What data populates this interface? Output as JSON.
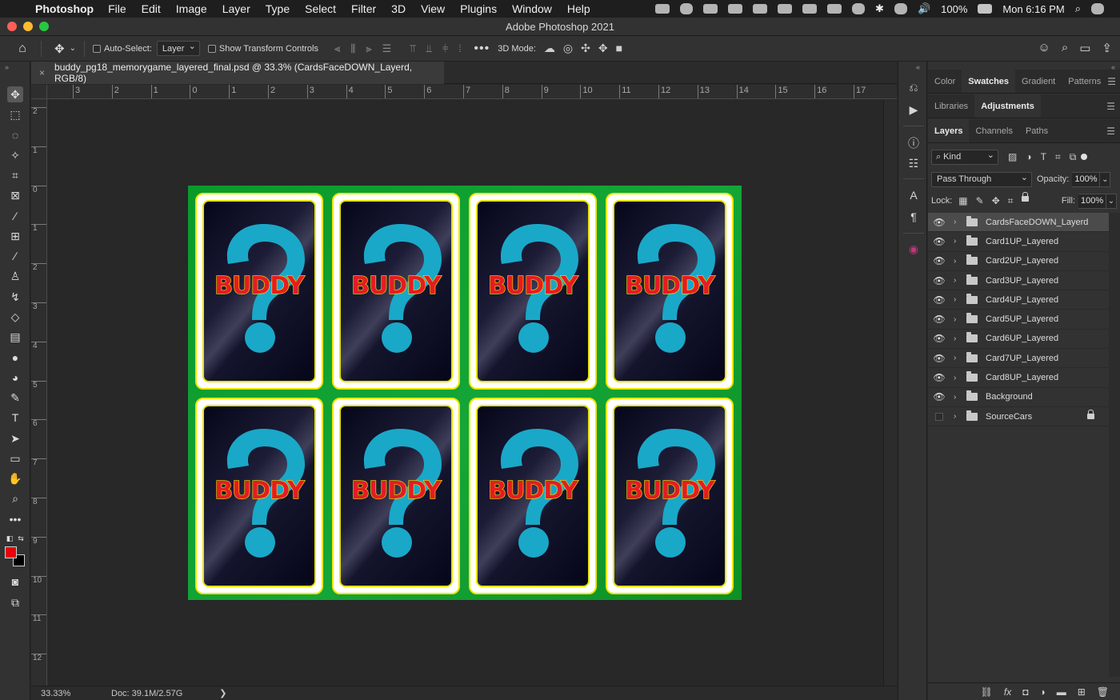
{
  "menubar": {
    "app_name": "Photoshop",
    "items": [
      "File",
      "Edit",
      "Image",
      "Layer",
      "Type",
      "Select",
      "Filter",
      "3D",
      "View",
      "Plugins",
      "Window",
      "Help"
    ],
    "battery": "100%",
    "clock": "Mon 6:16 PM"
  },
  "window": {
    "title": "Adobe Photoshop 2021"
  },
  "options": {
    "auto_select_label": "Auto-Select:",
    "auto_select_value": "Layer",
    "transform_label": "Show Transform Controls",
    "mode_3d_label": "3D Mode:"
  },
  "document": {
    "tab_title": "buddy_pg18_memorygame_layered_final.psd @ 33.3% (CardsFaceDOWN_Layerd, RGB/8)",
    "card_text": "BUDDY",
    "card_mark": "?"
  },
  "rulers": {
    "top": [
      "3",
      "2",
      "1",
      "0",
      "1",
      "2",
      "3",
      "4",
      "5",
      "6",
      "7",
      "8",
      "9",
      "10",
      "11",
      "12",
      "13",
      "14",
      "15",
      "16",
      "17"
    ],
    "left": [
      "2",
      "1",
      "0",
      "1",
      "2",
      "3",
      "4",
      "5",
      "6",
      "7",
      "8",
      "9",
      "10",
      "11",
      "12"
    ]
  },
  "status": {
    "zoom": "33.33%",
    "doc": "Doc: 39.1M/2.57G",
    "arrow": "❯"
  },
  "panels": {
    "group1": {
      "tabs": [
        "Color",
        "Swatches",
        "Gradient",
        "Patterns"
      ],
      "active": "Swatches"
    },
    "group2": {
      "tabs": [
        "Libraries",
        "Adjustments"
      ],
      "active": "Adjustments"
    },
    "group3": {
      "tabs": [
        "Layers",
        "Channels",
        "Paths"
      ],
      "active": "Layers"
    },
    "kind": "Kind",
    "blend_mode": "Pass Through",
    "opacity_label": "Opacity:",
    "opacity": "100%",
    "lock_label": "Lock:",
    "fill_label": "Fill:",
    "fill": "100%"
  },
  "layers": [
    {
      "name": "CardsFaceDOWN_Layerd",
      "visible": true,
      "selected": true,
      "locked": false
    },
    {
      "name": "Card1UP_Layered",
      "visible": true,
      "selected": false,
      "locked": false
    },
    {
      "name": "Card2UP_Layered",
      "visible": true,
      "selected": false,
      "locked": false
    },
    {
      "name": "Card3UP_Layered",
      "visible": true,
      "selected": false,
      "locked": false
    },
    {
      "name": "Card4UP_Layered",
      "visible": true,
      "selected": false,
      "locked": false
    },
    {
      "name": "Card5UP_Layered",
      "visible": true,
      "selected": false,
      "locked": false
    },
    {
      "name": "Card6UP_Layered",
      "visible": true,
      "selected": false,
      "locked": false
    },
    {
      "name": "Card7UP_Layered",
      "visible": true,
      "selected": false,
      "locked": false
    },
    {
      "name": "Card8UP_Layered",
      "visible": true,
      "selected": false,
      "locked": false
    },
    {
      "name": "Background",
      "visible": true,
      "selected": false,
      "locked": false
    },
    {
      "name": "SourceCars",
      "visible": false,
      "selected": false,
      "locked": true
    }
  ],
  "colors": {
    "foreground": "#e8000b",
    "background": "#000000",
    "artboard_green": "#0d9e2e",
    "card_question": "#1aa8c8",
    "card_text": "#e51c23",
    "card_outline": "#f5e600"
  }
}
